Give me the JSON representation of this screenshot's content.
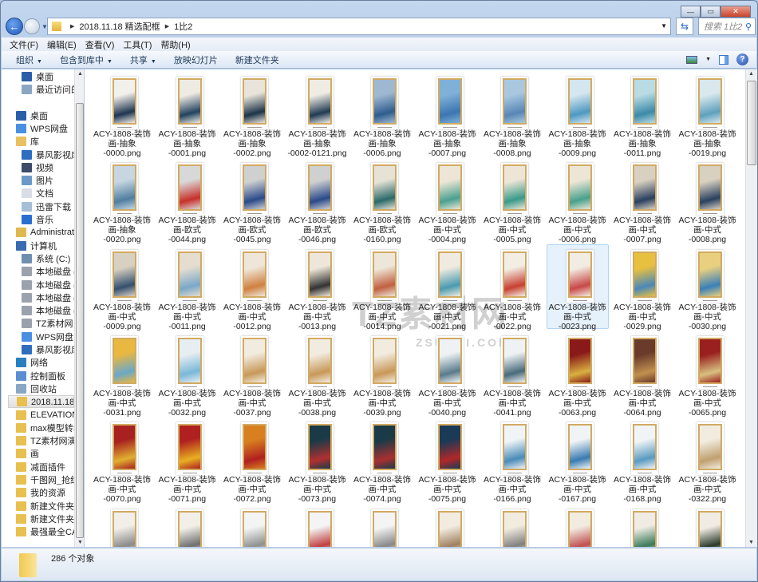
{
  "window": {
    "minimize": "—",
    "maximize": "▭",
    "close": "✕"
  },
  "address": {
    "crumbs": [
      "2018.11.18 精选配框",
      "1比2"
    ],
    "search_placeholder": "搜索 1比2"
  },
  "menu": [
    "文件(F)",
    "编辑(E)",
    "查看(V)",
    "工具(T)",
    "帮助(H)"
  ],
  "toolbar": [
    {
      "label": "组织",
      "dropdown": true
    },
    {
      "label": "包含到库中",
      "dropdown": true
    },
    {
      "label": "共享",
      "dropdown": true
    },
    {
      "label": "放映幻灯片",
      "dropdown": false
    },
    {
      "label": "新建文件夹",
      "dropdown": false
    }
  ],
  "sidebar": [
    {
      "label": "桌面",
      "indent": 1,
      "color": "#2a5fa8"
    },
    {
      "label": "最近访问的位",
      "indent": 1,
      "color": "#8aa6c4"
    },
    {
      "label": "桌面",
      "indent": 0,
      "color": "#2a5fa8",
      "gap": true
    },
    {
      "label": "WPS网盘",
      "indent": 0,
      "color": "#4a90e2"
    },
    {
      "label": "库",
      "indent": 0,
      "color": "#e8c060"
    },
    {
      "label": "暴风影视库",
      "indent": 1,
      "color": "#2f6dbf"
    },
    {
      "label": "视频",
      "indent": 1,
      "color": "#3c4c6a"
    },
    {
      "label": "图片",
      "indent": 1,
      "color": "#6b9ac8"
    },
    {
      "label": "文档",
      "indent": 1,
      "color": "#d8dde6"
    },
    {
      "label": "迅雷下载",
      "indent": 1,
      "color": "#a6bfd8"
    },
    {
      "label": "音乐",
      "indent": 1,
      "color": "#2a6fd0"
    },
    {
      "label": "Administrato",
      "indent": 0,
      "color": "#e0b850"
    },
    {
      "label": "计算机",
      "indent": 0,
      "color": "#3a6ab0"
    },
    {
      "label": "系统 (C:)",
      "indent": 1,
      "color": "#6f8fb0"
    },
    {
      "label": "本地磁盘 (D",
      "indent": 1,
      "color": "#9aa3ad"
    },
    {
      "label": "本地磁盘 (E",
      "indent": 1,
      "color": "#9aa3ad"
    },
    {
      "label": "本地磁盘 (F",
      "indent": 1,
      "color": "#9aa3ad"
    },
    {
      "label": "本地磁盘 (G",
      "indent": 1,
      "color": "#9aa3ad"
    },
    {
      "label": "TZ素材网 (",
      "indent": 1,
      "color": "#9aa3ad"
    },
    {
      "label": "WPS网盘",
      "indent": 1,
      "color": "#4a90e2"
    },
    {
      "label": "暴风影视库",
      "indent": 1,
      "color": "#2f6dbf"
    },
    {
      "label": "网络",
      "indent": 0,
      "color": "#2a7fbf"
    },
    {
      "label": "控制面板",
      "indent": 0,
      "color": "#5a8ed0"
    },
    {
      "label": "回收站",
      "indent": 0,
      "color": "#8aa6c4"
    },
    {
      "label": "2018.11.18 精",
      "indent": 0,
      "color": "#e8c050",
      "selected": true
    },
    {
      "label": "ELEVATION",
      "indent": 0,
      "color": "#e8c050"
    },
    {
      "label": "max模型转SU",
      "indent": 0,
      "color": "#e8c050"
    },
    {
      "label": "TZ素材网演示",
      "indent": 0,
      "color": "#e8c050"
    },
    {
      "label": "画",
      "indent": 0,
      "color": "#e8c050"
    },
    {
      "label": "减面插件",
      "indent": 0,
      "color": "#e8c050"
    },
    {
      "label": "千图网_抢红包",
      "indent": 0,
      "color": "#e8c050"
    },
    {
      "label": "我的资源",
      "indent": 0,
      "color": "#e8c050"
    },
    {
      "label": "新建文件夹",
      "indent": 0,
      "color": "#e8c050"
    },
    {
      "label": "新建文件夹 (",
      "indent": 0,
      "color": "#e8c050"
    },
    {
      "label": "最强最全CAD",
      "indent": 0,
      "color": "#e8c050"
    }
  ],
  "files": [
    {
      "name": "ACY-1808-装饰画-抽象-0000.png",
      "c": [
        "#f2f0ea",
        "#1f3550"
      ]
    },
    {
      "name": "ACY-1808-装饰画-抽象-0001.png",
      "c": [
        "#eeebe3",
        "#23425e"
      ]
    },
    {
      "name": "ACY-1808-装饰画-抽象-0002.png",
      "c": [
        "#e8e4da",
        "#1d3348"
      ]
    },
    {
      "name": "ACY-1808-装饰画-抽象-0002-0121.png",
      "c": [
        "#efece4",
        "#203a52"
      ]
    },
    {
      "name": "ACY-1808-装饰画-抽象-0006.png",
      "c": [
        "#9fb8d2",
        "#2f5d8e"
      ]
    },
    {
      "name": "ACY-1808-装饰画-抽象-0007.png",
      "c": [
        "#7fb0d8",
        "#3c76b0"
      ]
    },
    {
      "name": "ACY-1808-装饰画-抽象-0008.png",
      "c": [
        "#a9c8e0",
        "#5886b4"
      ]
    },
    {
      "name": "ACY-1808-装饰画-抽象-0009.png",
      "c": [
        "#d4e6ef",
        "#4e98c0"
      ]
    },
    {
      "name": "ACY-1808-装饰画-抽象-0011.png",
      "c": [
        "#b8dbe4",
        "#3b8aa8"
      ]
    },
    {
      "name": "ACY-1808-装饰画-抽象-0019.png",
      "c": [
        "#d8e8ee",
        "#5fa0bc"
      ]
    },
    {
      "name": "ACY-1808-装饰画-抽象-0020.png",
      "c": [
        "#c7d6e0",
        "#4f7ea0"
      ]
    },
    {
      "name": "ACY-1808-装饰画-欧式-0044.png",
      "c": [
        "#d8d8d8",
        "#c8302a"
      ]
    },
    {
      "name": "ACY-1808-装饰画-欧式-0045.png",
      "c": [
        "#d0d0d0",
        "#2a4a8a"
      ]
    },
    {
      "name": "ACY-1808-装饰画-欧式-0046.png",
      "c": [
        "#d0d0d0",
        "#2a4a8a"
      ]
    },
    {
      "name": "ACY-1808-装饰画-欧式-0160.png",
      "c": [
        "#e6e2d6",
        "#2a6a6a"
      ]
    },
    {
      "name": "ACY-1808-装饰画-中式-0004.png",
      "c": [
        "#ede6d6",
        "#4aa090"
      ]
    },
    {
      "name": "ACY-1808-装饰画-中式-0005.png",
      "c": [
        "#ede6d6",
        "#3a9a8a"
      ]
    },
    {
      "name": "ACY-1808-装饰画-中式-0006.png",
      "c": [
        "#ede6d6",
        "#48a08c"
      ]
    },
    {
      "name": "ACY-1808-装饰画-中式-0007.png",
      "c": [
        "#d8d0c0",
        "#2a4060"
      ]
    },
    {
      "name": "ACY-1808-装饰画-中式-0008.png",
      "c": [
        "#d8d0c0",
        "#2a4060"
      ]
    },
    {
      "name": "ACY-1808-装饰画-中式-0009.png",
      "c": [
        "#d8d0c0",
        "#34506e"
      ]
    },
    {
      "name": "ACY-1808-装饰画-中式-0011.png",
      "c": [
        "#e4ddd0",
        "#7aa8c8"
      ]
    },
    {
      "name": "ACY-1808-装饰画-中式-0012.png",
      "c": [
        "#eee6d8",
        "#d08040"
      ]
    },
    {
      "name": "ACY-1808-装饰画-中式-0013.png",
      "c": [
        "#eee6d8",
        "#333333"
      ]
    },
    {
      "name": "ACY-1808-装饰画-中式-0014.png",
      "c": [
        "#eee6d8",
        "#c06040"
      ]
    },
    {
      "name": "ACY-1808-装饰画-中式-0021.png",
      "c": [
        "#f0ebe0",
        "#4a9ab0"
      ]
    },
    {
      "name": "ACY-1808-装饰画-中式-0022.png",
      "c": [
        "#f2eee4",
        "#c84030"
      ]
    },
    {
      "name": "ACY-1808-装饰画-中式-0023.png",
      "c": [
        "#f2ede2",
        "#c84848"
      ],
      "selected": true
    },
    {
      "name": "ACY-1808-装饰画-中式-0029.png",
      "c": [
        "#e8c040",
        "#4a88b8"
      ]
    },
    {
      "name": "ACY-1808-装饰画-中式-0030.png",
      "c": [
        "#e8d080",
        "#3a80b8"
      ]
    },
    {
      "name": "ACY-1808-装饰画-中式-0031.png",
      "c": [
        "#e8b840",
        "#6aa8c8"
      ]
    },
    {
      "name": "ACY-1808-装饰画-中式-0032.png",
      "c": [
        "#e6eef2",
        "#7ab8d8"
      ]
    },
    {
      "name": "ACY-1808-装饰画-中式-0037.png",
      "c": [
        "#f2ece0",
        "#c89858"
      ]
    },
    {
      "name": "ACY-1808-装饰画-中式-0038.png",
      "c": [
        "#f2ece0",
        "#c89858"
      ]
    },
    {
      "name": "ACY-1808-装饰画-中式-0039.png",
      "c": [
        "#f2ece0",
        "#c89858"
      ]
    },
    {
      "name": "ACY-1808-装饰画-中式-0040.png",
      "c": [
        "#eef2f4",
        "#5a7a8a"
      ]
    },
    {
      "name": "ACY-1808-装饰画-中式-0041.png",
      "c": [
        "#eef2f4",
        "#4a6a7a"
      ]
    },
    {
      "name": "ACY-1808-装饰画-中式-0063.png",
      "c": [
        "#8a1a1a",
        "#d8b040"
      ]
    },
    {
      "name": "ACY-1808-装饰画-中式-0064.png",
      "c": [
        "#6a3a2a",
        "#c09050"
      ]
    },
    {
      "name": "ACY-1808-装饰画-中式-0065.png",
      "c": [
        "#9a2020",
        "#d8c080"
      ]
    },
    {
      "name": "ACY-1808-装饰画-中式-0070.png",
      "c": [
        "#a82020",
        "#e0b030"
      ]
    },
    {
      "name": "ACY-1808-装饰画-中式-0071.png",
      "c": [
        "#b02020",
        "#e8b020"
      ]
    },
    {
      "name": "ACY-1808-装饰画-中式-0072.png",
      "c": [
        "#d88020",
        "#b02020"
      ]
    },
    {
      "name": "ACY-1808-装饰画-中式-0073.png",
      "c": [
        "#1a3a48",
        "#b03030"
      ]
    },
    {
      "name": "ACY-1808-装饰画-中式-0074.png",
      "c": [
        "#1a3a48",
        "#a83030"
      ]
    },
    {
      "name": "ACY-1808-装饰画-中式-0075.png",
      "c": [
        "#1a3a58",
        "#b02828"
      ]
    },
    {
      "name": "ACY-1808-装饰画-中式-0166.png",
      "c": [
        "#f0f4f6",
        "#4a8ab8"
      ]
    },
    {
      "name": "ACY-1808-装饰画-中式-0167.png",
      "c": [
        "#f0f4f6",
        "#3a7ab0"
      ]
    },
    {
      "name": "ACY-1808-装饰画-中式-0168.png",
      "c": [
        "#f0f4f6",
        "#5a9ac0"
      ]
    },
    {
      "name": "ACY-1808-装饰画-中式-0322.png",
      "c": [
        "#f2ece0",
        "#c0a070"
      ]
    },
    {
      "c": [
        "#f2efe8",
        "#8a8a8a"
      ]
    },
    {
      "c": [
        "#f2efe8",
        "#707070"
      ]
    },
    {
      "c": [
        "#f4f4f4",
        "#909090"
      ]
    },
    {
      "c": [
        "#f4f4f4",
        "#c04040"
      ]
    },
    {
      "c": [
        "#f4f4f4",
        "#888888"
      ]
    },
    {
      "c": [
        "#f2ece0",
        "#a08060"
      ]
    },
    {
      "c": [
        "#f2ece0",
        "#808080"
      ]
    },
    {
      "c": [
        "#f2ece0",
        "#c05050"
      ]
    },
    {
      "c": [
        "#f0ece4",
        "#3a7a5a"
      ]
    },
    {
      "c": [
        "#f0ece4",
        "#2a3a2a"
      ]
    }
  ],
  "watermark": {
    "line1": "TZ素材网",
    "line2": "ZSUCAI.COM"
  },
  "status": {
    "count": "286 个对象"
  }
}
